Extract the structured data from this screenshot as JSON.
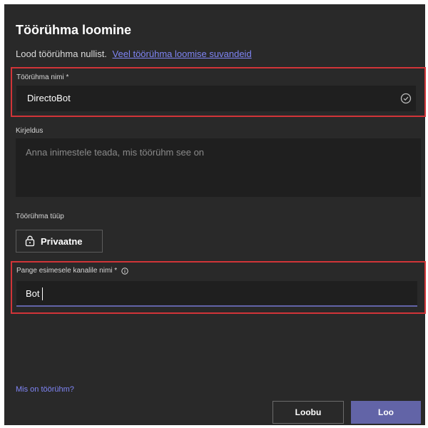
{
  "dialog": {
    "title": "Töörühma loomine",
    "subtitle": "Lood töörühma nullist.",
    "options_link": "Veel töörühma loomise suvandeid"
  },
  "team_name": {
    "label": "Töörühma nimi *",
    "value": "DirectoBot"
  },
  "description": {
    "label": "Kirjeldus",
    "placeholder": "Anna inimestele teada, mis töörühm see on"
  },
  "team_type": {
    "label": "Töörühma tüüp",
    "value": "Privaatne"
  },
  "channel_name": {
    "label": "Pange esimesele kanalile nimi *",
    "value": "Bot"
  },
  "footer": {
    "help_link": "Mis on töörühm?",
    "cancel_label": "Loobu",
    "create_label": "Loo"
  },
  "colors": {
    "accent": "#6264a7",
    "highlight": "#d13438",
    "link": "#7f85f5"
  }
}
